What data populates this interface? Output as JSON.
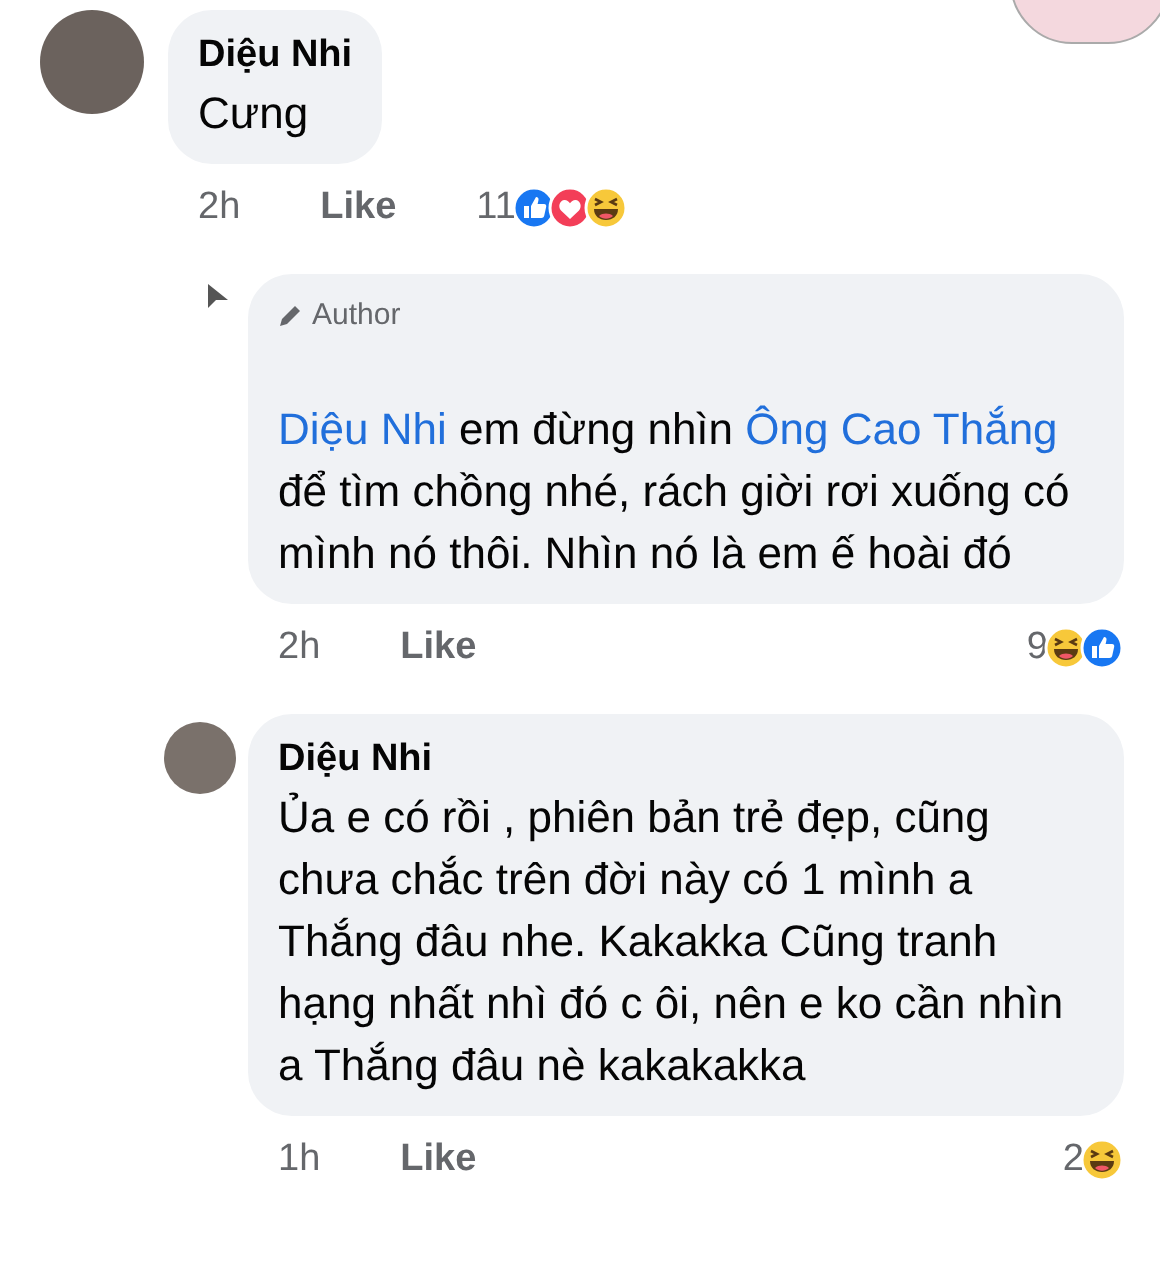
{
  "comments": [
    {
      "kind": "top",
      "author": "Diệu Nhi",
      "body": [
        {
          "kind": "text",
          "text": "Cưng"
        }
      ],
      "time": "2h",
      "like": "Like",
      "reaction_count": "11",
      "reactions": [
        {
          "kind": "like"
        },
        {
          "kind": "love"
        },
        {
          "kind": "haha"
        }
      ]
    },
    {
      "kind": "reply",
      "badge": "Author",
      "body": [
        {
          "kind": "mention",
          "text": "Diệu Nhi"
        },
        {
          "kind": "text",
          "text": " em đừng nhìn "
        },
        {
          "kind": "mention",
          "text": "Ông Cao Thắng"
        },
        {
          "kind": "text",
          "text": "  để tìm chồng nhé, rách giời rơi xuống có mình nó thôi. Nhìn nó là em ế hoài đó"
        }
      ],
      "time": "2h",
      "like": "Like",
      "reaction_count": "9",
      "reactions": [
        {
          "kind": "haha"
        },
        {
          "kind": "like"
        }
      ]
    },
    {
      "kind": "reply",
      "author": "Diệu Nhi",
      "body": [
        {
          "kind": "text",
          "text": "Ủa e có rồi , phiên bản trẻ đẹp, cũng chưa chắc trên đời này có 1 mình a Thắng đâu nhe. Kakakka Cũng tranh hạng nhất nhì đó c ôi, nên e ko cần nhìn a Thắng đâu nè kakakakka"
        }
      ],
      "time": "1h",
      "like": "Like",
      "reaction_count": "2",
      "reactions": [
        {
          "kind": "haha"
        }
      ]
    }
  ]
}
